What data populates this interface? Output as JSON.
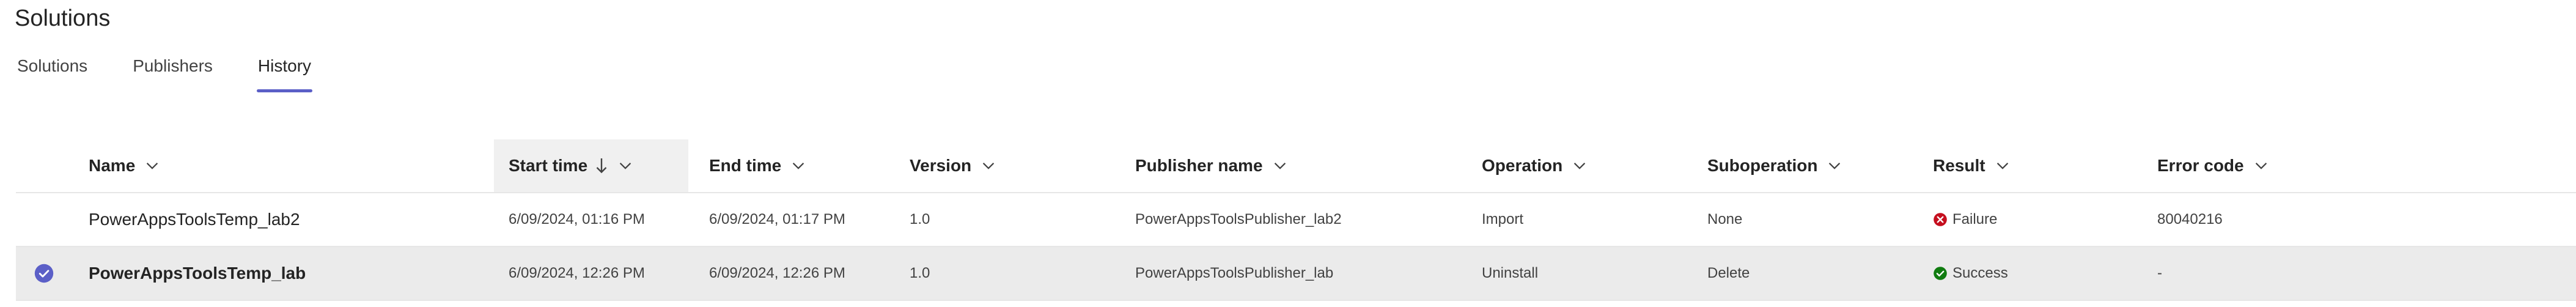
{
  "page": {
    "title": "Solutions"
  },
  "tabs": [
    {
      "label": "Solutions",
      "selected": false
    },
    {
      "label": "Publishers",
      "selected": false
    },
    {
      "label": "History",
      "selected": true
    }
  ],
  "columns": {
    "name": "Name",
    "start_time": "Start time",
    "end_time": "End time",
    "version": "Version",
    "publisher_name": "Publisher name",
    "operation": "Operation",
    "suboperation": "Suboperation",
    "result": "Result",
    "error_code": "Error code"
  },
  "rows": [
    {
      "name": "PowerAppsToolsTemp_lab2",
      "start_time": "6/09/2024, 01:16 PM",
      "end_time": "6/09/2024, 01:17 PM",
      "version": "1.0",
      "publisher_name": "PowerAppsToolsPublisher_lab2",
      "operation": "Import",
      "suboperation": "None",
      "result": "Failure",
      "error_code": "80040216",
      "selected": false
    },
    {
      "name": "PowerAppsToolsTemp_lab",
      "start_time": "6/09/2024, 12:26 PM",
      "end_time": "6/09/2024, 12:26 PM",
      "version": "1.0",
      "publisher_name": "PowerAppsToolsPublisher_lab",
      "operation": "Uninstall",
      "suboperation": "Delete",
      "result": "Success",
      "error_code": "-",
      "selected": true
    }
  ],
  "colors": {
    "accent": "#5b5fc7",
    "failure": "#c50f1f",
    "success": "#107c10",
    "selected_row": "#ebebeb",
    "sorted_header": "#f0f0f0"
  },
  "icons": {
    "sort": "arrow-down-icon",
    "column_menu": "chevron-down-icon",
    "failure": "error-circle-icon",
    "success": "checkmark-circle-icon",
    "row_selected": "checkmark-circle-icon"
  }
}
